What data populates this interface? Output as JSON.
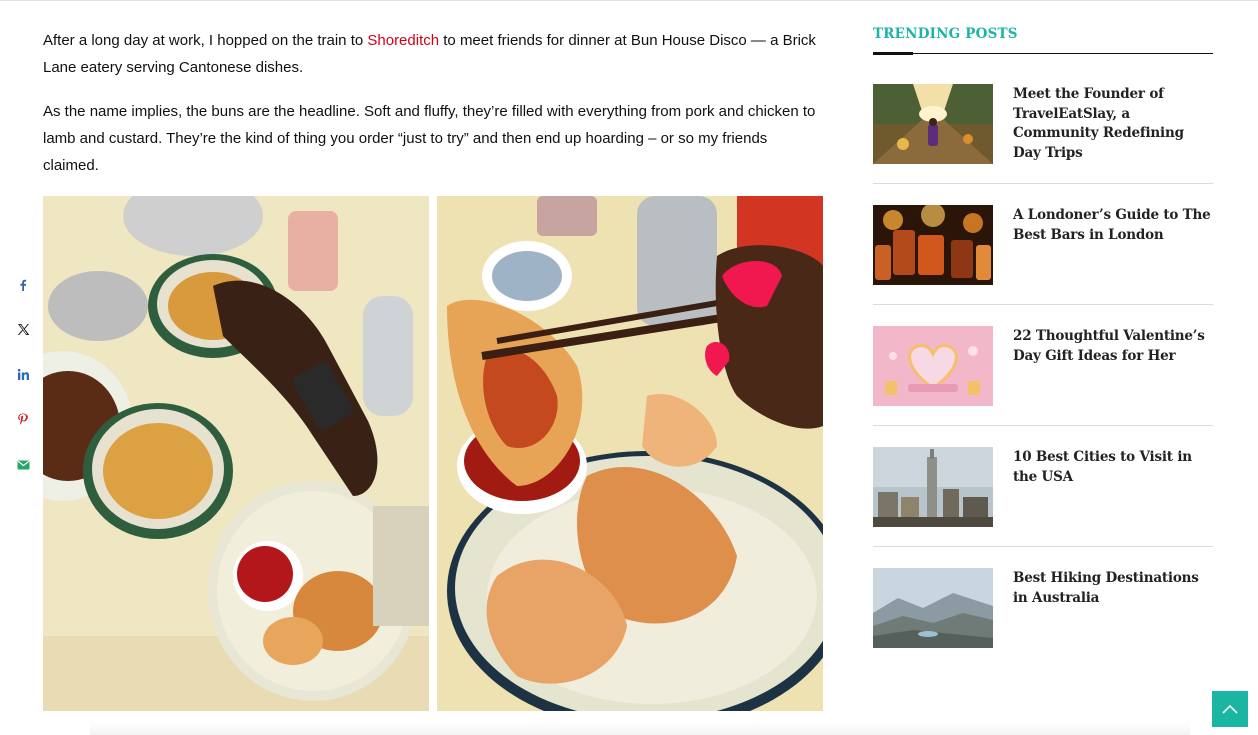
{
  "article": {
    "p1_before": "After a long day at work, I hopped on the train to ",
    "p1_link": "Shoreditch",
    "p1_after": " to meet friends for dinner at Bun House Disco — a Brick Lane eatery serving Cantonese dishes.",
    "p2": "As the name implies, the buns are the headline. Soft and fluffy, they’re filled with everything from pork and chicken to lamb and custard. They’re the kind of thing you order “just to try” and then end up hoarding – or so my friends claimed."
  },
  "share": {
    "buttons": [
      "facebook-icon",
      "x-icon",
      "linkedin-icon",
      "pinterest-icon",
      "email-icon"
    ]
  },
  "sidebar": {
    "title": "TRENDING POSTS",
    "posts": [
      {
        "title": "Meet the Founder of TravelEatSlay, a Community Redefining Day Trips"
      },
      {
        "title": "A Londoner’s Guide to The Best Bars in London"
      },
      {
        "title": "22 Thoughtful Valentine’s Day Gift Ideas for Her"
      },
      {
        "title": "10 Best Cities to Visit in the USA"
      },
      {
        "title": "Best Hiking Destinations in Australia"
      }
    ]
  },
  "colors": {
    "accent": "#1ab5a3",
    "link": "#d0021b",
    "share": "#4a6fb5"
  },
  "icons": {
    "back_to_top": "chevron-up-icon"
  }
}
